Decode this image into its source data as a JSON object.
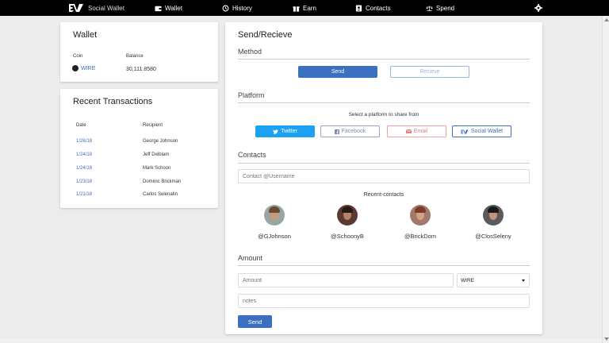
{
  "nav": {
    "brand": "Social Wallet",
    "items": [
      {
        "label": "Wallet",
        "icon": "wallet-icon"
      },
      {
        "label": "History",
        "icon": "history-icon"
      },
      {
        "label": "Earn",
        "icon": "gift-icon"
      },
      {
        "label": "Contacts",
        "icon": "contacts-icon"
      },
      {
        "label": "Spend",
        "icon": "scale-icon"
      }
    ],
    "settings_icon": "gear-icon"
  },
  "wallet": {
    "title": "Wallet",
    "coin_header": "Coin",
    "balance_header": "Balance",
    "coin": "WIRE",
    "balance": "30,111.8580"
  },
  "transactions": {
    "title": "Recent Transactions",
    "date_header": "Date",
    "recipient_header": "Recipient",
    "rows": [
      {
        "date": "1/26/18",
        "recipient": "George Johnson"
      },
      {
        "date": "1/24/18",
        "recipient": "Jeff Delblam"
      },
      {
        "date": "1/24/18",
        "recipient": "Mark Schoon"
      },
      {
        "date": "1/23/18",
        "recipient": "Dominic Brickman"
      },
      {
        "date": "1/21/18",
        "recipient": "Carlos Selenakn"
      }
    ]
  },
  "send": {
    "title": "Send/Recieve",
    "method_label": "Method",
    "send_label": "Send",
    "recieve_label": "Recieve",
    "platform_label": "Platform",
    "platform_hint": "Select a platform to share from",
    "platforms": {
      "twitter": "Twitter",
      "facebook": "Facebook",
      "email": "Email",
      "social_wallet": "Social Wallet"
    },
    "contacts_label": "Contacts",
    "contact_placeholder": "Contact @Username",
    "recent_contacts_label": "Recent-contacts",
    "recent_contacts": [
      {
        "handle": "@GJohnson",
        "hair": "#6b4a35",
        "face": "#c99a7a"
      },
      {
        "handle": "@SchoonyB",
        "hair": "#2a1a14",
        "face": "#b98565"
      },
      {
        "handle": "@BrickDom",
        "hair": "#7a3b2a",
        "face": "#d2a285"
      },
      {
        "handle": "@ClosSeleny",
        "hair": "#1a1a1a",
        "face": "#c4947a"
      }
    ],
    "amount_label": "Amount",
    "amount_placeholder": "Amount",
    "currency": "WIRE",
    "notes_placeholder": "notes",
    "submit_label": "Send"
  },
  "colors": {
    "accent": "#3b6fbf",
    "twitter": "#1da1f2",
    "nav_bg": "#000000"
  }
}
